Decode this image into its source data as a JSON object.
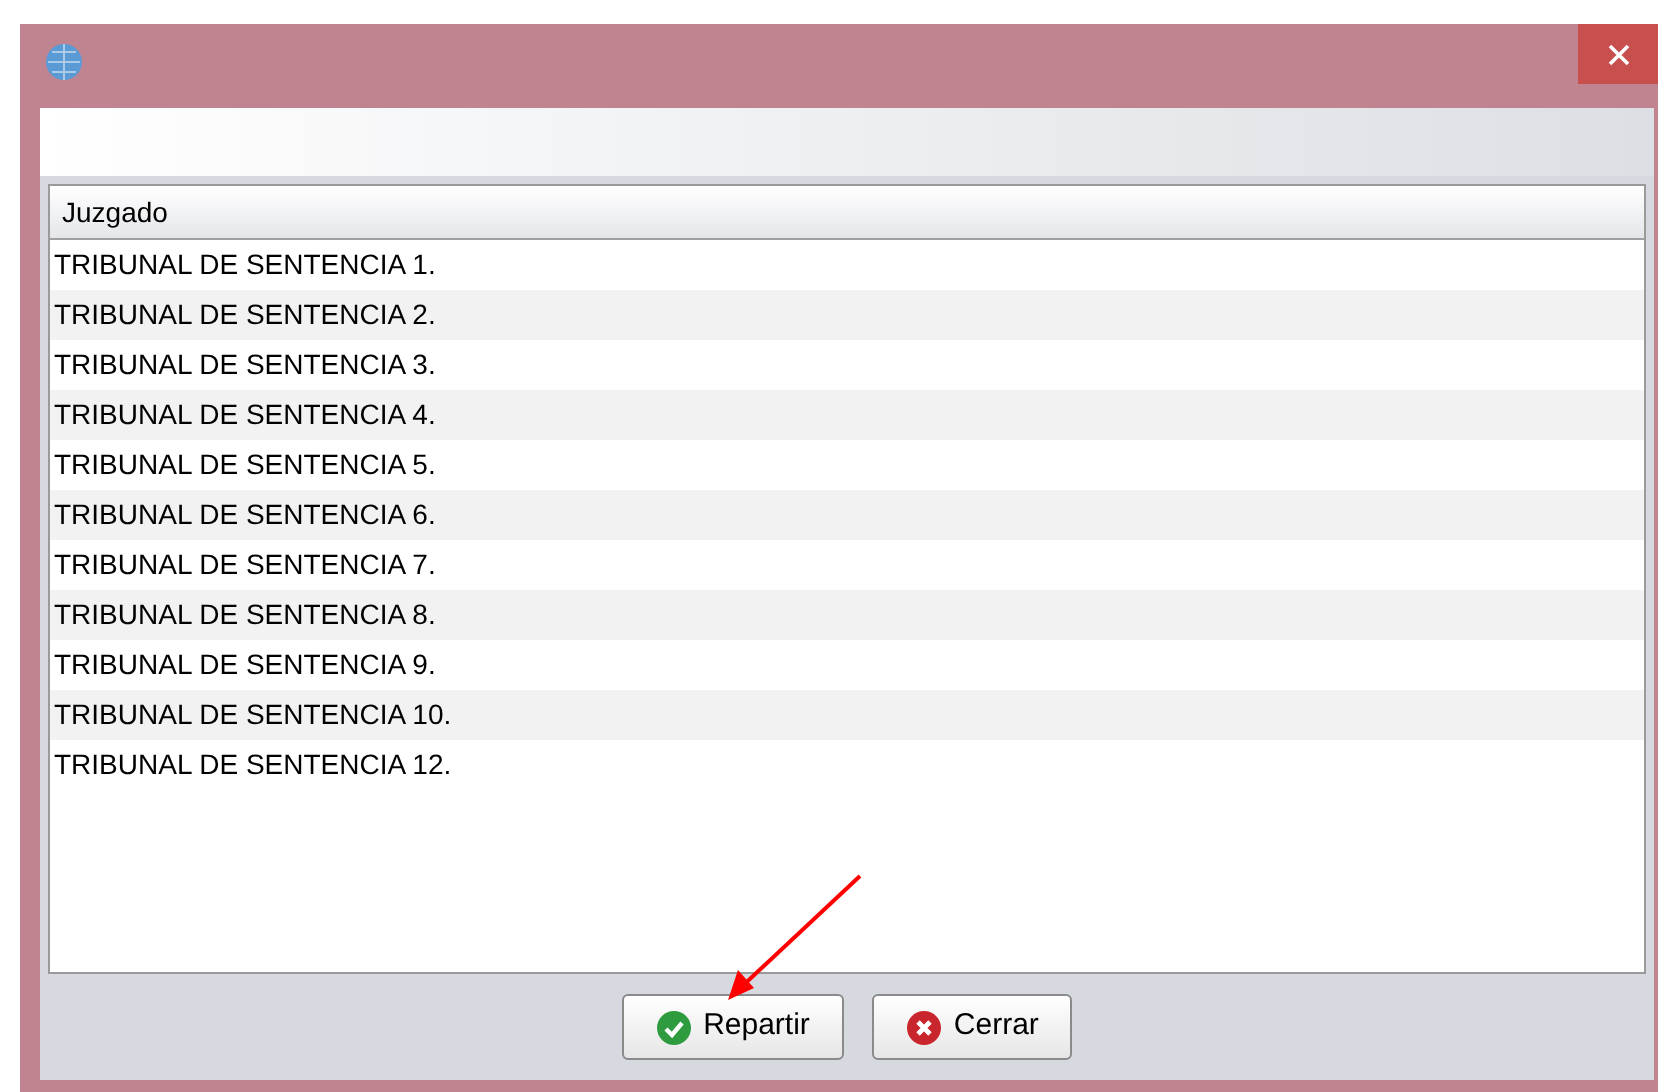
{
  "table": {
    "columns": [
      "Juzgado"
    ],
    "rows": [
      {
        "cells": [
          "TRIBUNAL DE SENTENCIA 1."
        ]
      },
      {
        "cells": [
          "TRIBUNAL DE SENTENCIA 2."
        ]
      },
      {
        "cells": [
          "TRIBUNAL DE SENTENCIA 3."
        ]
      },
      {
        "cells": [
          "TRIBUNAL DE SENTENCIA 4."
        ]
      },
      {
        "cells": [
          "TRIBUNAL DE SENTENCIA 5."
        ]
      },
      {
        "cells": [
          "TRIBUNAL DE SENTENCIA 6."
        ]
      },
      {
        "cells": [
          "TRIBUNAL DE SENTENCIA 7."
        ]
      },
      {
        "cells": [
          "TRIBUNAL DE SENTENCIA 8."
        ]
      },
      {
        "cells": [
          "TRIBUNAL DE SENTENCIA 9."
        ]
      },
      {
        "cells": [
          "TRIBUNAL DE SENTENCIA 10."
        ]
      },
      {
        "cells": [
          "TRIBUNAL DE SENTENCIA 12."
        ]
      }
    ]
  },
  "buttons": [
    {
      "label": "Repartir",
      "kind": "ok"
    },
    {
      "label": "Cerrar",
      "kind": "cancel"
    }
  ]
}
